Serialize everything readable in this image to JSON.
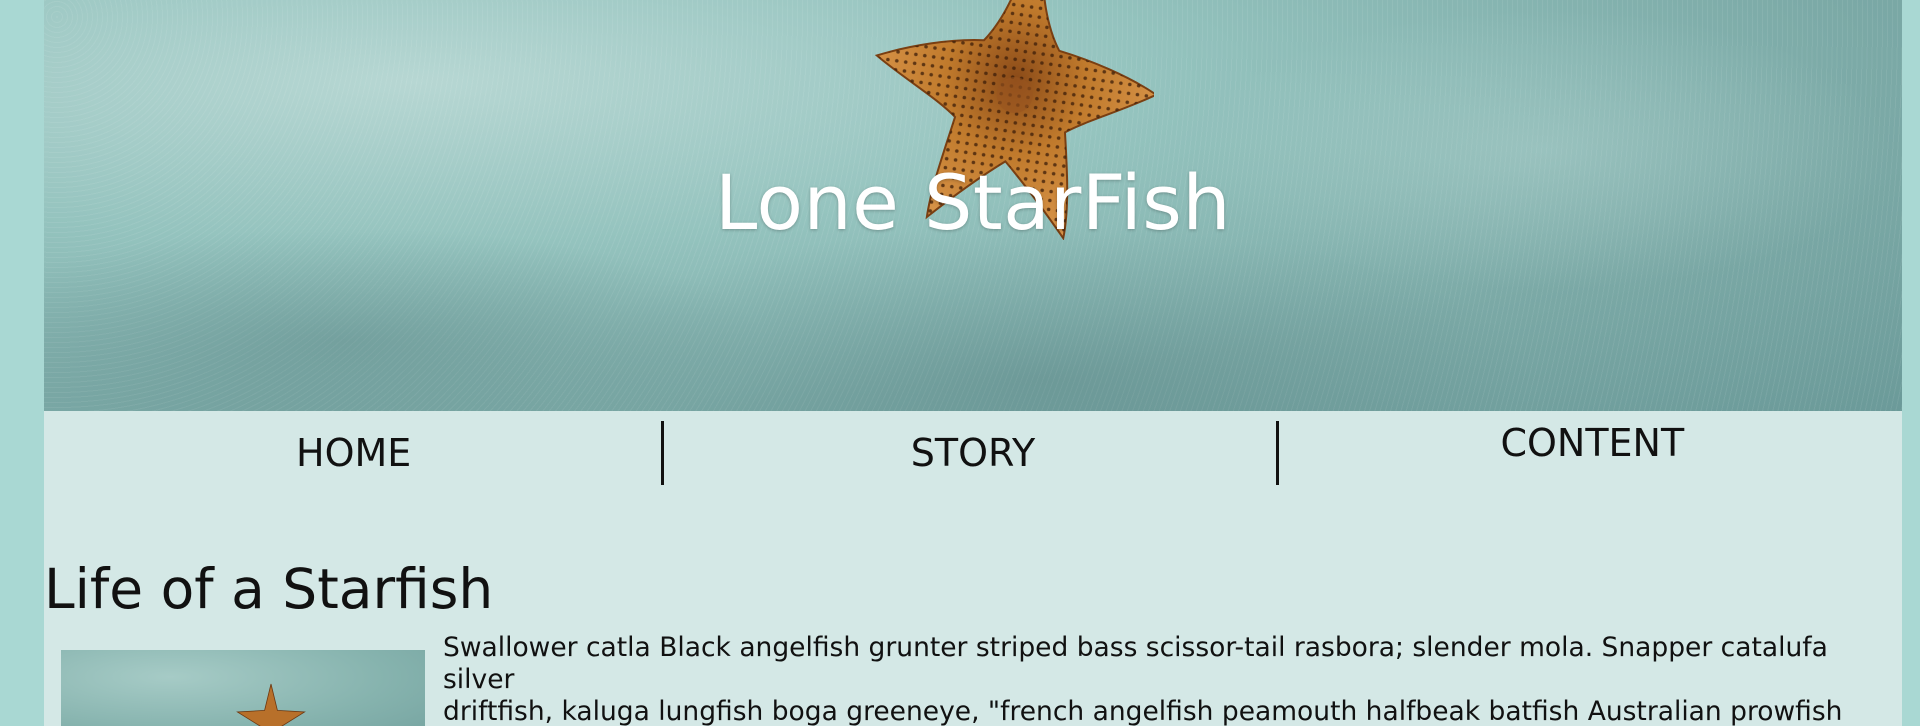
{
  "header": {
    "title": "Lone StarFish"
  },
  "nav": {
    "items": [
      {
        "label": "HOME"
      },
      {
        "label": "STORY"
      },
      {
        "label": "CONTENT"
      }
    ]
  },
  "main": {
    "section_title": "Life of a Starfish",
    "paragraph": "Swallower catla Black angelfish grunter striped bass scissor-tail rasbora; slender mola. Snapper catalufa silver\ndriftfish, kaluga lungfish boga greeneye, \"french angelfish peamouth halfbeak batfish Australian prowfish\nmouthbrooder.\" Gibberfish tui chub mooneye smoothtongue; amur pike barbeled houndshark dwarf loach"
  },
  "colors": {
    "page_background": "#a9d8d3",
    "content_background": "#d4e8e6",
    "title_color": "#ffffff",
    "starfish_color": "#c07a2c"
  },
  "icons": {
    "hero_image": "starfish-on-sand-image",
    "thumbnail_image": "starfish-thumbnail-image"
  }
}
